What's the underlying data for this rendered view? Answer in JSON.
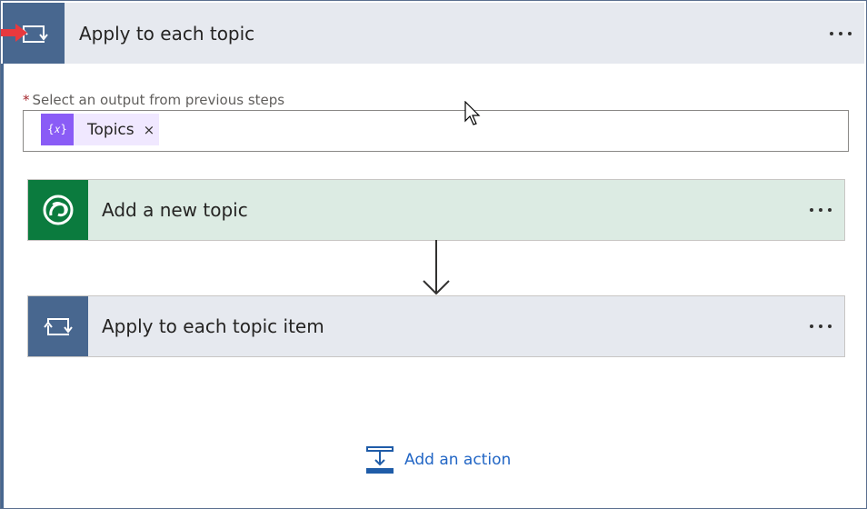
{
  "loop": {
    "title": "Apply to each topic",
    "icon": "loop-icon",
    "accent": "#48678f"
  },
  "output_field": {
    "label": "Select an output from previous steps",
    "required_marker": "*",
    "token": {
      "label": "Topics",
      "icon": "expression-icon",
      "icon_glyph": "{𝑥}",
      "remove_glyph": "×"
    }
  },
  "actions": [
    {
      "title": "Add a new topic",
      "icon": "dataverse-icon",
      "color": "#0b7b3e"
    },
    {
      "title": "Apply to each topic item",
      "icon": "loop-icon",
      "color": "#48678f"
    }
  ],
  "add_action": {
    "label": "Add an action",
    "icon": "insert-step-icon"
  }
}
